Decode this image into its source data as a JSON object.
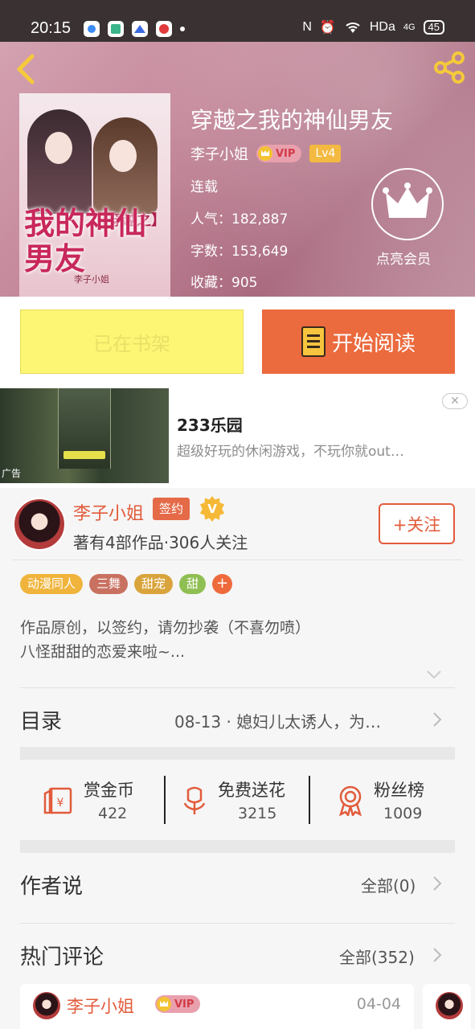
{
  "status_bar": {
    "time": "20:15",
    "network": "HDa",
    "signal": "4G",
    "battery": "45"
  },
  "book": {
    "title": "穿越之我的神仙男友",
    "author": "李子小姐",
    "vip": "VIP",
    "level": "Lv4",
    "status": "连载",
    "popularity": "人气：182,887",
    "word_count": "字数：153,649",
    "favorites": "收藏：905",
    "member_label": "点亮会员",
    "cover": {
      "title_main": "我的神仙男友",
      "title_sub": "【穿越之】",
      "author": "李子小姐"
    }
  },
  "actions": {
    "shelf_label": "已在书架",
    "read_label": "开始阅读"
  },
  "ad": {
    "title": "233乐园",
    "description": "超级好玩的休闲游戏，不玩你就out…",
    "tag": "广告",
    "close": "✕"
  },
  "author_card": {
    "name": "李子小姐",
    "signed": "签约",
    "verified": "V",
    "stats": "著有4部作品·306人关注",
    "follow_label": "+关注",
    "tags": [
      {
        "label": "动漫同人",
        "color": "#f0b43c"
      },
      {
        "label": "三舞",
        "color": "#c97161"
      },
      {
        "label": "甜宠",
        "color": "#d9a43c"
      },
      {
        "label": "甜",
        "color": "#8fbf52"
      }
    ],
    "tag_more": "+",
    "description_line1": "作品原创，以签约，请勿抄袭（不喜勿喷）",
    "description_line2": "八怪甜甜的恋爱来啦~..."
  },
  "catalog": {
    "title": "目录",
    "latest": "08-13 · 媳妇儿太诱人，为…"
  },
  "rewards": {
    "coins_label": "赏金币",
    "coins_value": "422",
    "flowers_label": "免费送花",
    "flowers_value": "3215",
    "fans_label": "粉丝榜",
    "fans_value": "1009"
  },
  "author_says": {
    "title": "作者说",
    "all_label": "全部(0)"
  },
  "hot_comments": {
    "title": "热门评论",
    "all_label": "全部(352)",
    "first": {
      "name": "李子小姐",
      "vip": "VIP",
      "date": "04-04"
    }
  },
  "colors": {
    "accent": "#eb6a3e",
    "shelf": "#fdf574",
    "author_red": "#e25b3b"
  }
}
